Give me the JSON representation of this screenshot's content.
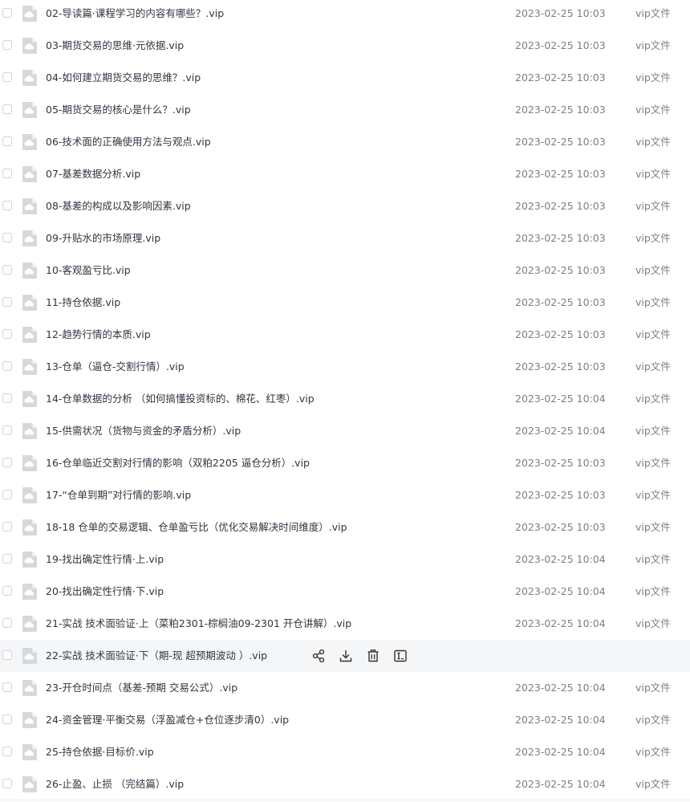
{
  "file_list": {
    "rows": [
      {
        "name": "02-导读篇·课程学习的内容有哪些？.vip",
        "date": "2023-02-25 10:03",
        "type": "vip文件"
      },
      {
        "name": "03-期货交易的思维·元依据.vip",
        "date": "2023-02-25 10:03",
        "type": "vip文件"
      },
      {
        "name": "04-如何建立期货交易的思维？.vip",
        "date": "2023-02-25 10:03",
        "type": "vip文件"
      },
      {
        "name": "05-期货交易的核心是什么？.vip",
        "date": "2023-02-25 10:03",
        "type": "vip文件"
      },
      {
        "name": "06-技术面的正确使用方法与观点.vip",
        "date": "2023-02-25 10:03",
        "type": "vip文件"
      },
      {
        "name": "07-基差数据分析.vip",
        "date": "2023-02-25 10:03",
        "type": "vip文件"
      },
      {
        "name": "08-基差的构成以及影响因素.vip",
        "date": "2023-02-25 10:03",
        "type": "vip文件"
      },
      {
        "name": "09-升贴水的市场原理.vip",
        "date": "2023-02-25 10:03",
        "type": "vip文件"
      },
      {
        "name": "10-客观盈亏比.vip",
        "date": "2023-02-25 10:03",
        "type": "vip文件"
      },
      {
        "name": "11-持仓依据.vip",
        "date": "2023-02-25 10:03",
        "type": "vip文件"
      },
      {
        "name": "12-趋势行情的本质.vip",
        "date": "2023-02-25 10:03",
        "type": "vip文件"
      },
      {
        "name": "13-仓单（逼仓-交割行情）.vip",
        "date": "2023-02-25 10:03",
        "type": "vip文件"
      },
      {
        "name": "14-仓单数据的分析 （如何搞懂投资标的、棉花、红枣）.vip",
        "date": "2023-02-25 10:04",
        "type": "vip文件"
      },
      {
        "name": "15-供需状况（货物与资金的矛盾分析）.vip",
        "date": "2023-02-25 10:04",
        "type": "vip文件"
      },
      {
        "name": "16-仓单临近交割对行情的影响（双粕2205 逼仓分析）.vip",
        "date": "2023-02-25 10:03",
        "type": "vip文件"
      },
      {
        "name": "17-“仓单到期”对行情的影响.vip",
        "date": "2023-02-25 10:03",
        "type": "vip文件"
      },
      {
        "name": "18-18 仓单的交易逻辑、仓单盈亏比（优化交易解决时间维度）.vip",
        "date": "2023-02-25 10:03",
        "type": "vip文件"
      },
      {
        "name": "19-找出确定性行情·上.vip",
        "date": "2023-02-25 10:04",
        "type": "vip文件"
      },
      {
        "name": "20-找出确定性行情·下.vip",
        "date": "2023-02-25 10:04",
        "type": "vip文件"
      },
      {
        "name": "21-实战 技术面验证·上（菜粕2301-棕榈油09-2301 开仓讲解）.vip",
        "date": "2023-02-25 10:04",
        "type": "vip文件"
      },
      {
        "name": "22-实战 技术面验证·下（期-现 超预期波动 ）.vip",
        "date": "",
        "type": "",
        "hovered": true
      },
      {
        "name": "23-开仓时间点（基差-预期 交易公式）.vip",
        "date": "2023-02-25 10:04",
        "type": "vip文件"
      },
      {
        "name": "24-资金管理·平衡交易（浮盈减仓+仓位逐步清0）.vip",
        "date": "2023-02-25 10:04",
        "type": "vip文件"
      },
      {
        "name": "25-持仓依据·目标价.vip",
        "date": "2023-02-25 10:04",
        "type": "vip文件"
      },
      {
        "name": "26-止盈、止损 （完结篇）.vip",
        "date": "2023-02-25 10:04",
        "type": "vip文件"
      }
    ],
    "hover_actions": [
      "share-icon",
      "download-icon",
      "delete-icon",
      "rename-icon"
    ],
    "colors": {
      "name_text": "#2f3640",
      "meta_text": "#7a8088",
      "hover_bg": "#f5f6f8",
      "icon_gray": "#d5d8dd"
    }
  }
}
